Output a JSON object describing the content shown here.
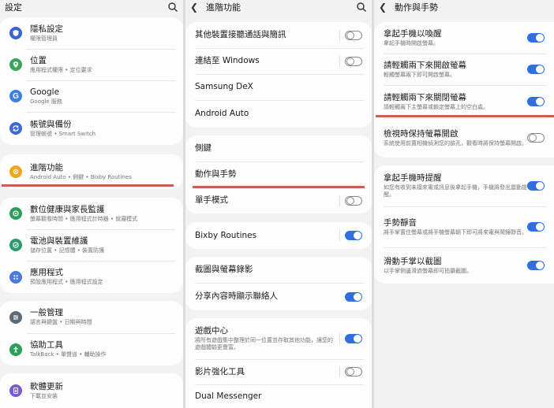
{
  "panel1": {
    "title": "設定",
    "groups": [
      [
        {
          "title": "隱私設定",
          "subtitle": "權限管理員",
          "icon": "shield-icon",
          "color": "#3b63d8"
        },
        {
          "title": "位置",
          "subtitle": "應用程式權限 • 定位要求",
          "icon": "location-pin-icon",
          "color": "#3aa65a"
        },
        {
          "title": "Google",
          "subtitle": "Google 服務",
          "icon": "google-g-icon",
          "color": "#3d7fe6"
        },
        {
          "title": "帳號與備份",
          "subtitle": "管理帳號 • Smart Switch",
          "icon": "sync-icon",
          "color": "#3d69d6"
        }
      ],
      [
        {
          "title": "進階功能",
          "subtitle": "Android Auto • 側鍵 • Bixby Routines",
          "icon": "gear-plus-icon",
          "color": "#f0a820"
        }
      ],
      [
        {
          "title": "數位健康與家長監護",
          "subtitle": "螢幕觀看時間 • 應用程式計時器 • 就寢模式",
          "icon": "wellbeing-icon",
          "color": "#2d9e5a"
        },
        {
          "title": "電池與裝置維護",
          "subtitle": "儲存位置 • 記憶體 • 裝置防護",
          "icon": "device-care-icon",
          "color": "#2a9a6e"
        },
        {
          "title": "應用程式",
          "subtitle": "預設應用程式 • 應用程式設定",
          "icon": "apps-grid-icon",
          "color": "#4a79e0"
        }
      ],
      [
        {
          "title": "一般管理",
          "subtitle": "語言與鍵盤 • 日期與時間",
          "icon": "sliders-icon",
          "color": "#5d6a78"
        },
        {
          "title": "協助工具",
          "subtitle": "TalkBack • 單聲道 • 輔助操作",
          "icon": "accessibility-icon",
          "color": "#2d9e5a"
        }
      ],
      [
        {
          "title": "軟體更新",
          "subtitle": "下載並安裝",
          "icon": "software-update-icon",
          "color": "#7a5cd6"
        }
      ]
    ]
  },
  "panel2": {
    "title": "進階功能",
    "groups": [
      [
        {
          "title": "其他裝置接聽通話與簡訊",
          "toggle": "off"
        },
        {
          "title": "連結至 Windows",
          "toggle": "off"
        },
        {
          "title": "Samsung DeX"
        },
        {
          "title": "Android Auto"
        }
      ],
      [
        {
          "title": "側鍵"
        },
        {
          "title": "動作與手勢"
        },
        {
          "title": "單手模式",
          "toggle": "off"
        }
      ],
      [
        {
          "title": "Bixby Routines",
          "toggle": "on"
        }
      ],
      [
        {
          "title": "截圖與螢幕錄影"
        },
        {
          "title": "分享內容時顯示聯絡人",
          "toggle": "on"
        }
      ],
      [
        {
          "title": "遊戲中心",
          "subtitle": "將所有遊戲集中整理於同一位置並存取其他功能，讓您的遊戲體驗更豐富。",
          "toggle": "on"
        },
        {
          "title": "影片強化工具",
          "toggle": "off"
        },
        {
          "title": "Dual Messenger"
        }
      ]
    ]
  },
  "panel3": {
    "title": "動作與手勢",
    "groups": [
      [
        {
          "title": "拿起手機以喚醒",
          "subtitle": "拿起手機時開啟螢幕。",
          "toggle": "on"
        },
        {
          "title": "請輕觸兩下來開啟螢幕",
          "subtitle": "輕觸螢幕兩下即可開啟螢幕。",
          "toggle": "on"
        },
        {
          "title": "請輕觸兩下來關閉螢幕",
          "subtitle": "請輕觸兩下主螢幕或鎖定螢幕上的空白處。",
          "toggle": "on"
        },
        {
          "title": "檢視時保持螢幕開啟",
          "subtitle": "系統使用前置相機偵測您的臉孔，觀看時將保持螢幕開啟。",
          "toggle": "off"
        }
      ],
      [
        {
          "title": "拿起手機時提醒",
          "subtitle": "如您有收到未接來電或訊息後拿起手機，手機將發出震動提醒。",
          "toggle": "on"
        },
        {
          "title": "手勢靜音",
          "subtitle": "將手掌置住螢幕或將手機螢幕朝下即可將來電與鬧鐘靜音。",
          "toggle": "on"
        },
        {
          "title": "滑動手掌以截圖",
          "subtitle": "以手掌側邊滑過螢幕即可拍攝截圖。",
          "toggle": "on"
        }
      ]
    ]
  }
}
